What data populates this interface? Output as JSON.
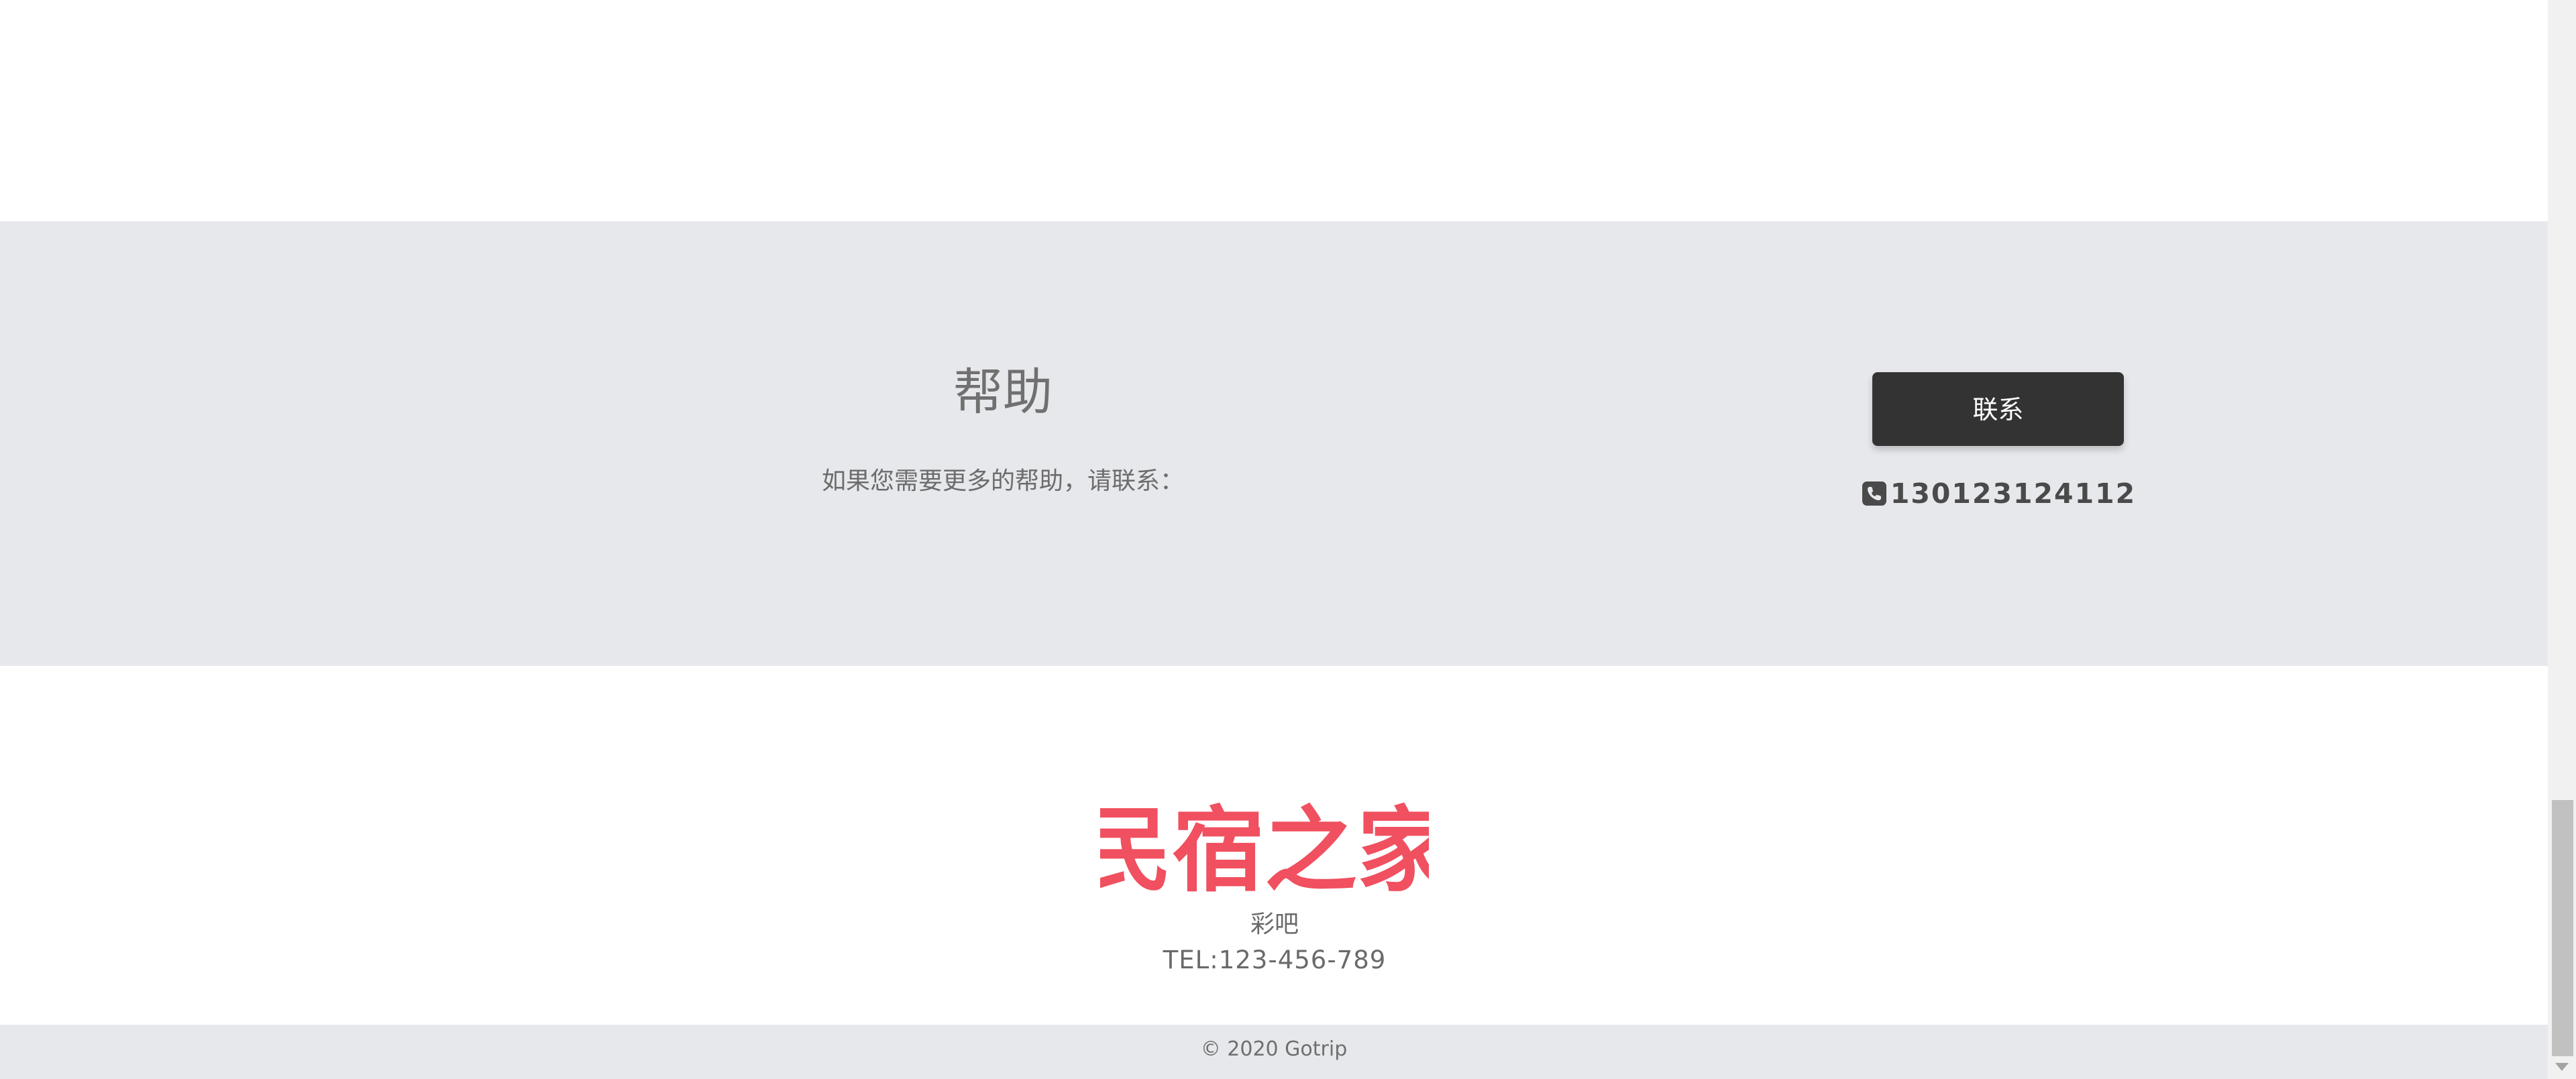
{
  "help": {
    "title": "帮助",
    "description": "如果您需要更多的帮助，请联系：",
    "contact_button_label": "联系",
    "phone_icon": "phone-icon",
    "phone_number": "130123124112"
  },
  "brand": {
    "logo_text": "民宿之家",
    "logo_color": "#f0505f",
    "name": "彩吧",
    "tel": "TEL:123-456-789"
  },
  "footer": {
    "copyright": "© 2020 Gotrip"
  },
  "colors": {
    "section_bg": "#e7e8ec",
    "button_bg": "#333333",
    "button_text": "#ffffff"
  }
}
